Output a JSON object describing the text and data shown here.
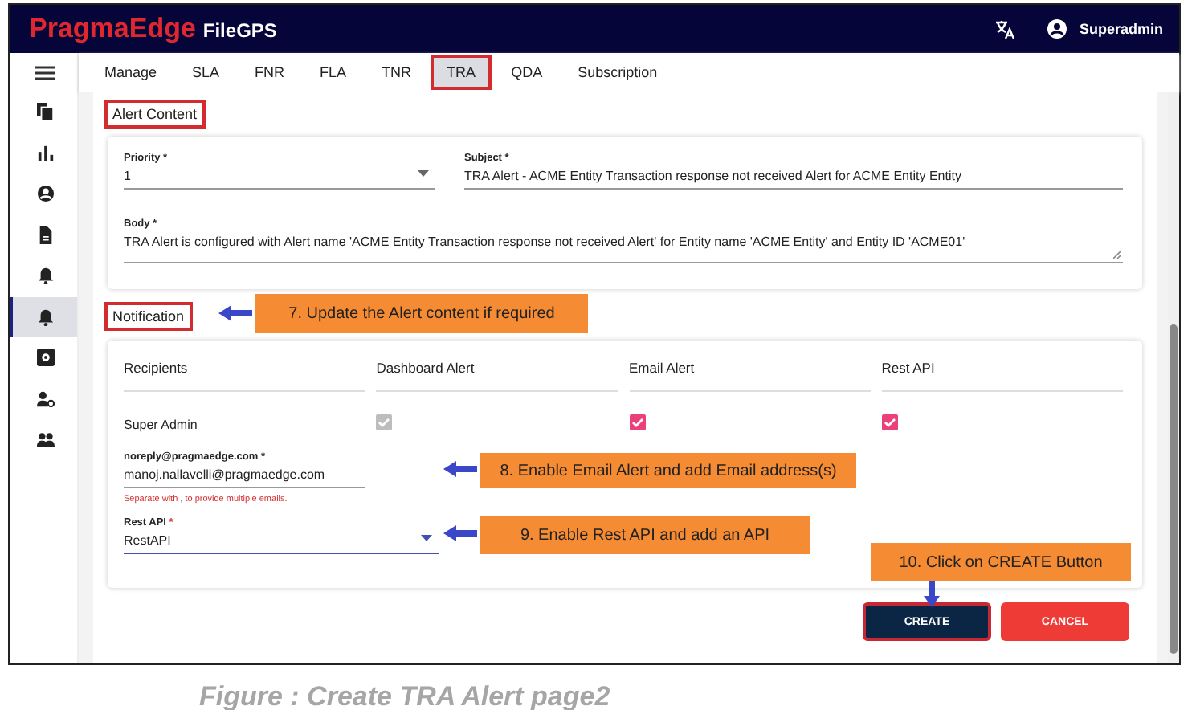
{
  "app": {
    "brand": "PragmaEdge",
    "product": "FileGPS",
    "user": "Superadmin"
  },
  "sidebar": {
    "items": [
      {
        "selected": false
      },
      {
        "selected": false
      },
      {
        "selected": false
      },
      {
        "selected": false
      },
      {
        "selected": false
      },
      {
        "selected": true
      },
      {
        "selected": false
      },
      {
        "selected": false
      },
      {
        "selected": false
      }
    ]
  },
  "tabs": [
    {
      "label": "Manage",
      "selected": false
    },
    {
      "label": "SLA",
      "selected": false
    },
    {
      "label": "FNR",
      "selected": false
    },
    {
      "label": "FLA",
      "selected": false
    },
    {
      "label": "TNR",
      "selected": false
    },
    {
      "label": "TRA",
      "selected": true
    },
    {
      "label": "QDA",
      "selected": false
    },
    {
      "label": "Subscription",
      "selected": false
    }
  ],
  "alert_content": {
    "heading": "Alert Content",
    "highlighted": true,
    "priority": {
      "label": "Priority *",
      "value": "1"
    },
    "subject": {
      "label": "Subject *",
      "value": "TRA Alert - ACME Entity Transaction response not received Alert for ACME Entity Entity"
    },
    "body": {
      "label": "Body *",
      "value": "TRA Alert is configured with Alert name 'ACME Entity Transaction response not received Alert' for Entity name 'ACME Entity' and Entity ID 'ACME01'"
    }
  },
  "notification": {
    "heading": "Notification",
    "highlighted": true,
    "columns": [
      "Recipients",
      "Dashboard Alert",
      "Email Alert",
      "Rest API"
    ],
    "rows": [
      {
        "recipient": "Super Admin",
        "dashboard": {
          "checked": true,
          "disabled": true
        },
        "email": {
          "checked": true,
          "disabled": false
        },
        "rest": {
          "checked": true,
          "disabled": false
        }
      }
    ],
    "email_field": {
      "label": "noreply@pragmaedge.com *",
      "value": "manoj.nallavelli@pragmaedge.com",
      "hint": "Separate with , to provide multiple emails."
    },
    "rest_api": {
      "label": "Rest API",
      "required": "*",
      "value": "RestAPI"
    }
  },
  "buttons": [
    {
      "label": "CREATE",
      "kind": "primary",
      "highlighted": true
    },
    {
      "label": "CANCEL",
      "kind": "danger",
      "highlighted": false
    }
  ],
  "callouts": [
    {
      "text": "7. Update the Alert content if required"
    },
    {
      "text": "8. Enable Email Alert and add Email address(s)"
    },
    {
      "text": "9. Enable Rest API and add an API"
    },
    {
      "text": "10. Click on CREATE Button"
    }
  ],
  "caption": "Figure : Create TRA Alert page2"
}
